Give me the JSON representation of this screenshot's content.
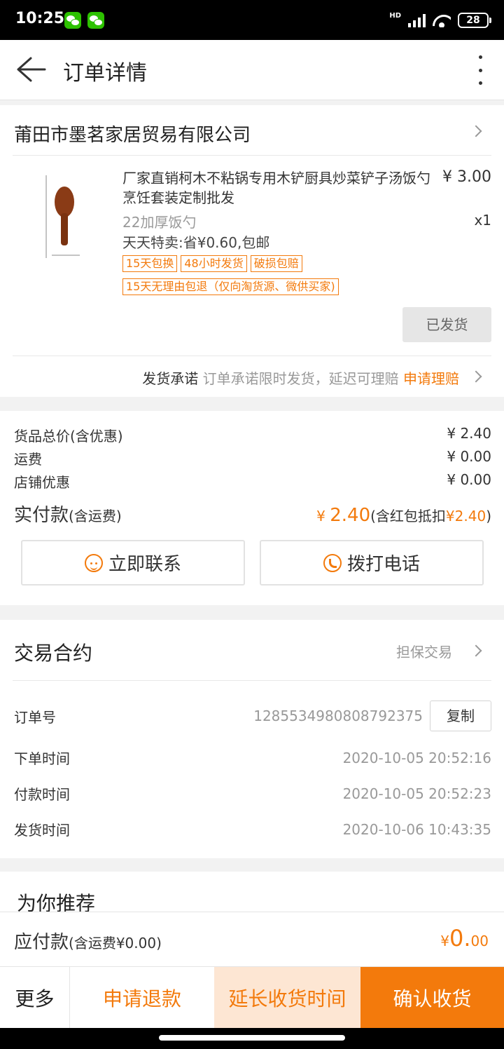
{
  "status_bar": {
    "time": "10:25",
    "network": "HD",
    "battery": "28"
  },
  "header": {
    "title": "订单详情"
  },
  "shop": {
    "name": "莆田市墨茗家居贸易有限公司"
  },
  "product": {
    "title": "厂家直销柯木不粘锅专用木铲厨具炒菜铲子汤饭勺烹饪套装定制批发",
    "price": "¥ 3.00",
    "quantity": "x1",
    "sku": "22加厚饭勺",
    "promo": "天天特卖:省¥0.60,包邮",
    "tags": [
      "15天包换",
      "48小时发货",
      "破损包赔"
    ],
    "tags_line2": [
      "15天无理由包退（仅向淘货源、微供买家)"
    ],
    "status": "已发货"
  },
  "promise": {
    "key": "发货承诺",
    "desc": "订单承诺限时发货，延迟可理赔",
    "action": "申请理赔"
  },
  "price_summary": {
    "goods_label": "货品总价(含优惠)",
    "goods_value": "¥ 2.40",
    "shipping_label": "运费",
    "shipping_value": "¥ 0.00",
    "discount_label": "店铺优惠",
    "discount_value": "¥ 0.00",
    "paid_label": "实付款",
    "paid_label_small": "(含运费)",
    "paid_currency": "¥",
    "paid_amount": "2.40",
    "paid_note_prefix": "(含红包抵扣",
    "paid_note_amount": "¥2.40",
    "paid_note_suffix": ")"
  },
  "contact": {
    "chat_label": "立即联系",
    "call_label": "拨打电话"
  },
  "contract": {
    "title": "交易合约",
    "type": "担保交易",
    "order_no_label": "订单号",
    "order_no": "1285534980808792375",
    "copy_label": "复制",
    "order_time_label": "下单时间",
    "order_time": "2020-10-05 20:52:16",
    "pay_time_label": "付款时间",
    "pay_time": "2020-10-05 20:52:23",
    "ship_time_label": "发货时间",
    "ship_time": "2020-10-06 10:43:35"
  },
  "recommend": {
    "title": "为你推荐"
  },
  "due": {
    "label": "应付款",
    "label_small": "(含运费¥0.00)",
    "currency": "¥",
    "int": "0.",
    "dec": "00"
  },
  "actions": {
    "more": "更多",
    "refund": "申请退款",
    "extend": "延长收货时间",
    "confirm": "确认收货"
  },
  "colors": {
    "accent": "#f37a0c",
    "accent_light": "#fde6d3"
  }
}
